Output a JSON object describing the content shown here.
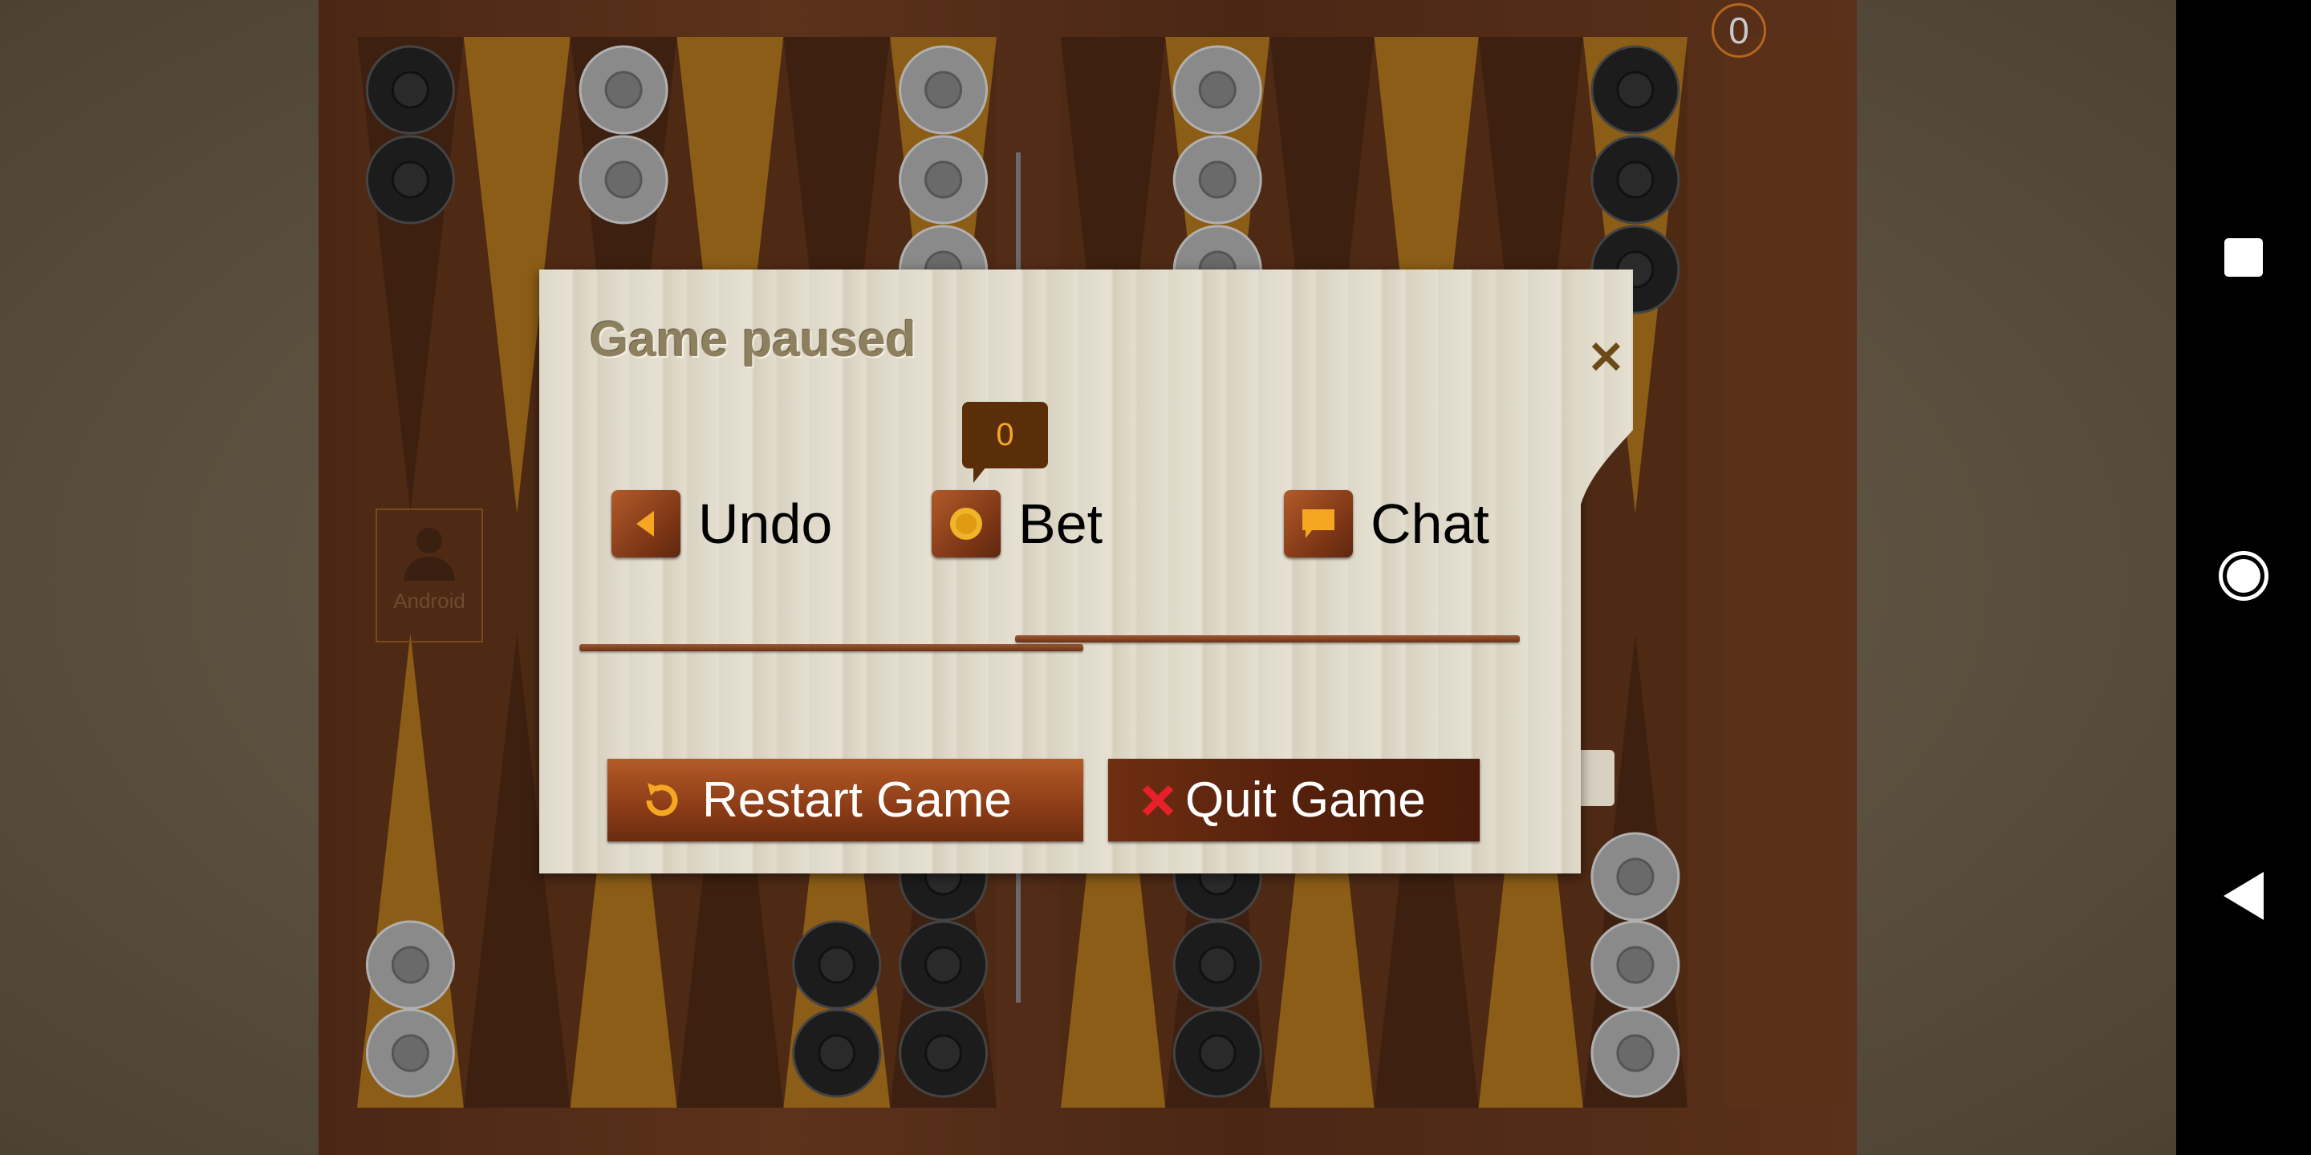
{
  "game": {
    "counter": "0",
    "player_name": "Android",
    "colors": {
      "dark_point": "#3d2010",
      "light_point": "#8c5d16",
      "black_checker": "#1c1c1c",
      "white_checker": "#8a8a8a"
    },
    "checkers": {
      "top": [
        {
          "point": 0,
          "color": "black",
          "count": 2
        },
        {
          "point": 2,
          "color": "white",
          "count": 2
        },
        {
          "point": 5,
          "color": "white",
          "count": 3
        },
        {
          "point": 7,
          "color": "white",
          "count": 3
        },
        {
          "point": 11,
          "color": "black",
          "count": 3
        }
      ],
      "bottom": [
        {
          "point": 0,
          "color": "white",
          "count": 2
        },
        {
          "point": 4,
          "color": "black",
          "count": 2
        },
        {
          "point": 5,
          "color": "black",
          "count": 3
        },
        {
          "point": 7,
          "color": "black",
          "count": 3
        },
        {
          "point": 11,
          "color": "white",
          "count": 3
        }
      ]
    }
  },
  "dialog": {
    "title": "Game paused",
    "close_icon": "close-icon",
    "bet_amount": "0",
    "actions": [
      {
        "label": "Undo",
        "icon": "undo-arrow-icon"
      },
      {
        "label": "Bet",
        "icon": "coin-icon"
      },
      {
        "label": "Chat",
        "icon": "chat-bubble-icon"
      }
    ],
    "buttons": {
      "restart": {
        "label": "Restart Game",
        "icon": "restart-icon"
      },
      "quit": {
        "label": "Quit Game",
        "icon": "x-icon"
      }
    }
  },
  "navbar": {
    "items": [
      "recents",
      "home",
      "back"
    ]
  }
}
